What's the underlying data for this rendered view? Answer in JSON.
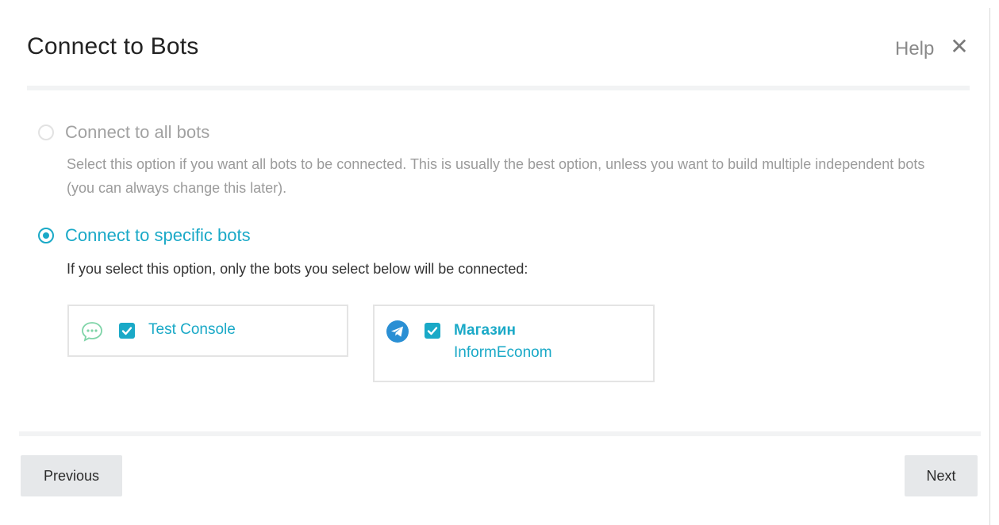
{
  "dialog": {
    "title": "Connect to Bots",
    "help_label": "Help",
    "close_glyph": "✕"
  },
  "options": {
    "all": {
      "label": "Connect to all bots",
      "selected": false,
      "description": "Select this option if you want all bots to be connected. This is usually the best option, unless you want to build multiple independent bots (you can always change this later)."
    },
    "specific": {
      "label": "Connect to specific bots",
      "selected": true,
      "description": "If you select this option, only the bots you select below will be connected:"
    }
  },
  "bots": [
    {
      "name": "Test Console",
      "channel_icon": "chat-bubble-icon",
      "checked": true
    },
    {
      "name_line1": "Магазин",
      "name_line2": "InformEconom",
      "channel_icon": "telegram-icon",
      "checked": true
    }
  ],
  "footer": {
    "previous_label": "Previous",
    "next_label": "Next"
  },
  "colors": {
    "accent": "#1aa9c7",
    "chat_icon": "#7fd4a8",
    "telegram_icon": "#2a8fd4",
    "button_bg": "#e6e8ea"
  }
}
